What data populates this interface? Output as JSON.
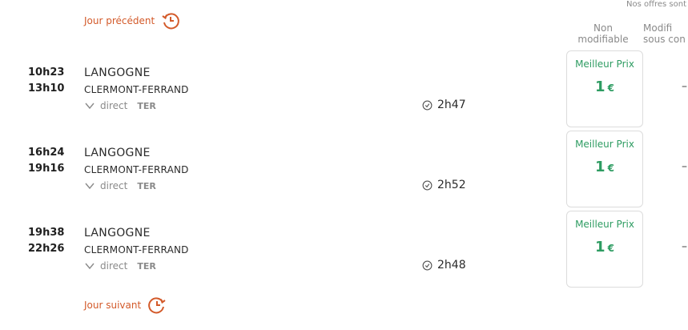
{
  "notice": "Nos offres sont",
  "nav": {
    "prev_label": "Jour précédent",
    "next_label": "Jour suivant"
  },
  "columns": {
    "non_modifiable": [
      "Non",
      "modifiable"
    ],
    "modifiable": [
      "Modifi",
      "sous con"
    ]
  },
  "trips": [
    {
      "dep_time": "10h23",
      "arr_time": "13h10",
      "origin": "LANGOGNE",
      "destination": "CLERMONT-FERRAND",
      "stops": "direct",
      "train_type": "TER",
      "duration": "2h47",
      "badge": "Meilleur Prix",
      "price": "1",
      "currency": "€",
      "modifiable": "–"
    },
    {
      "dep_time": "16h24",
      "arr_time": "19h16",
      "origin": "LANGOGNE",
      "destination": "CLERMONT-FERRAND",
      "stops": "direct",
      "train_type": "TER",
      "duration": "2h52",
      "badge": "Meilleur Prix",
      "price": "1",
      "currency": "€",
      "modifiable": "–"
    },
    {
      "dep_time": "19h38",
      "arr_time": "22h26",
      "origin": "LANGOGNE",
      "destination": "CLERMONT-FERRAND",
      "stops": "direct",
      "train_type": "TER",
      "duration": "2h48",
      "badge": "Meilleur Prix",
      "price": "1",
      "currency": "€",
      "modifiable": "–"
    }
  ],
  "colors": {
    "accent_orange": "#d35a2a",
    "price_green": "#2e9c62",
    "muted": "#8a8a8a"
  }
}
